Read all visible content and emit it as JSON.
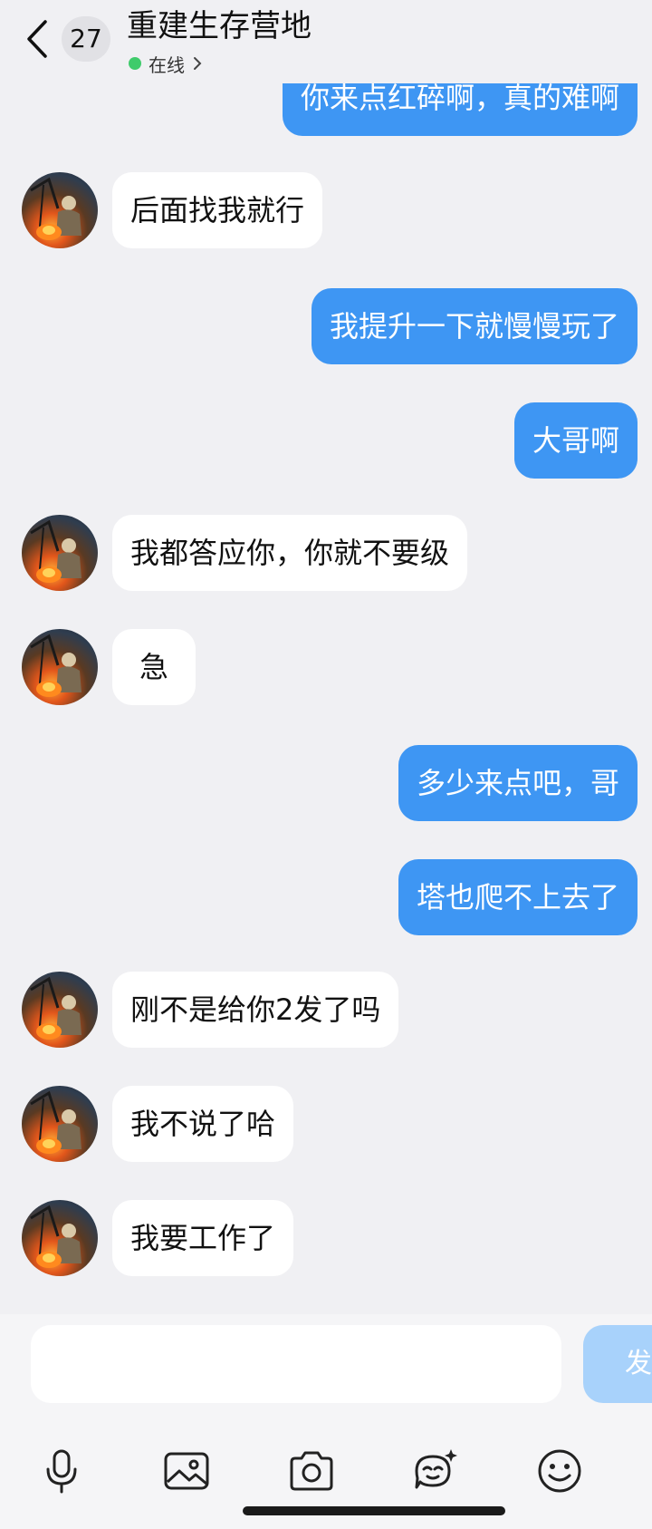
{
  "header": {
    "unread_count": "27",
    "title": "重建生存营地",
    "status": "在线"
  },
  "messages": [
    {
      "dir": "out",
      "text": "你来点红碎啊，真的难啊"
    },
    {
      "dir": "in",
      "text": "后面找我就行"
    },
    {
      "dir": "out",
      "text": "我提升一下就慢慢玩了"
    },
    {
      "dir": "out",
      "text": "大哥啊"
    },
    {
      "dir": "in",
      "text": "我都答应你，你就不要级"
    },
    {
      "dir": "in",
      "text": "急"
    },
    {
      "dir": "out",
      "text": "多少来点吧，哥"
    },
    {
      "dir": "out",
      "text": "塔也爬不上去了"
    },
    {
      "dir": "in",
      "text": "刚不是给你2发了吗"
    },
    {
      "dir": "in",
      "text": "我不说了哈"
    },
    {
      "dir": "in",
      "text": "我要工作了"
    }
  ],
  "input": {
    "placeholder": "",
    "send_label": "发"
  },
  "toolbar": {
    "icons": [
      "microphone-icon",
      "image-icon",
      "camera-icon",
      "sticker-icon",
      "emoji-icon"
    ]
  },
  "colors": {
    "outgoing_bubble": "#3e96f3",
    "incoming_bubble": "#ffffff",
    "background": "#f0f0f3",
    "online": "#3fcb6b"
  }
}
